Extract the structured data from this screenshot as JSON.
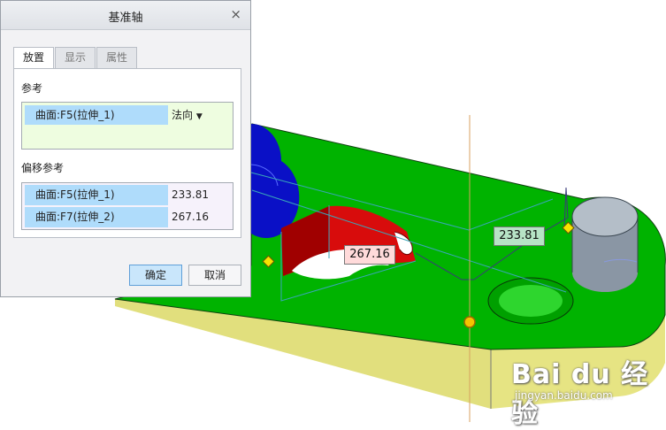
{
  "dialog": {
    "title": "基准轴",
    "close_glyph": "×",
    "tabs": [
      {
        "label": "放置",
        "active": true
      },
      {
        "label": "显示",
        "active": false
      },
      {
        "label": "属性",
        "active": false
      }
    ],
    "reference_section": {
      "title": "参考",
      "item": {
        "name": "曲面:F5(拉伸_1)",
        "type": "法向"
      }
    },
    "offset_section": {
      "title": "偏移参考",
      "items": [
        {
          "name": "曲面:F5(拉伸_1)",
          "value": "233.81"
        },
        {
          "name": "曲面:F7(拉伸_2)",
          "value": "267.16"
        }
      ]
    },
    "buttons": {
      "ok": "确定",
      "cancel": "取消"
    }
  },
  "viewport": {
    "dimension_labels": [
      "267.16",
      "233.81"
    ],
    "colors": {
      "top_face": "#00b400",
      "side_face": "#e2e07a",
      "hole_wall": "#cc1010",
      "cylinder": "#8a96a2",
      "blue_boss": "#0c14c8",
      "datum_line": "#3aa4b4",
      "axis_line": "#d49a4a",
      "handle": "#f4c800"
    }
  },
  "watermark": {
    "brand": "Bai du 经验",
    "site": "jingyan.baidu.com"
  }
}
